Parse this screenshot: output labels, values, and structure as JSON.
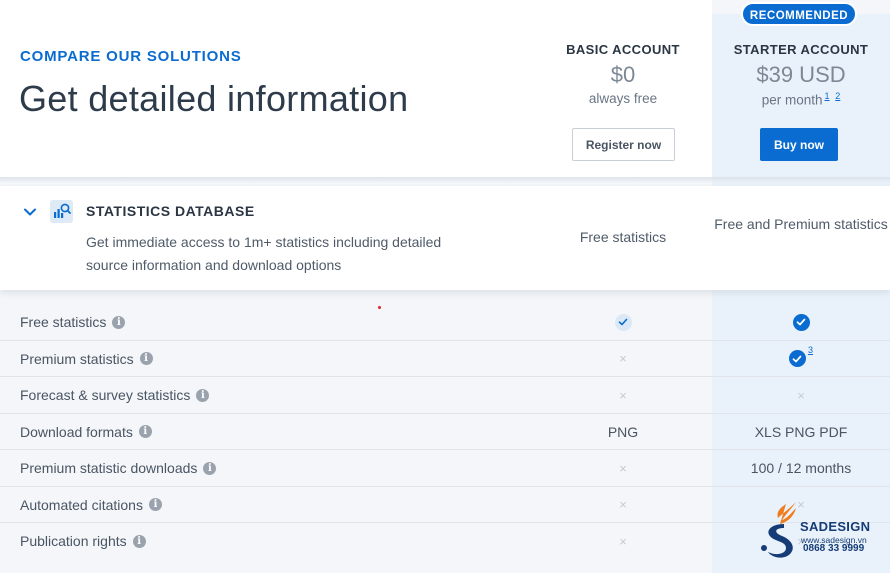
{
  "header": {
    "eyebrow": "COMPARE OUR SOLUTIONS",
    "title": "Get detailed information"
  },
  "plans": {
    "basic": {
      "title": "BASIC ACCOUNT",
      "price": "$0",
      "subtitle": "always free",
      "button": "Register now"
    },
    "starter": {
      "badge": "RECOMMENDED",
      "title": "STARTER ACCOUNT",
      "price": "$39 USD",
      "subtitle": "per month",
      "footnote_1": "1",
      "footnote_2": "2",
      "button": "Buy now"
    }
  },
  "category": {
    "title": "STATISTICS DATABASE",
    "description": "Get immediate access to 1m+ statistics including detailed source information and download options",
    "basic_value": "Free statistics",
    "starter_value": "Free and Premium statistics",
    "chevron_icon": "chevron-down-icon",
    "category_icon": "chart-search-icon"
  },
  "features": [
    {
      "label": "Free statistics",
      "basic": "check",
      "starter": "check"
    },
    {
      "label": "Premium statistics",
      "basic": "x",
      "starter": "check",
      "starter_footnote": "3"
    },
    {
      "label": "Forecast & survey statistics",
      "basic": "x",
      "starter": "x"
    },
    {
      "label": "Download formats",
      "basic_text": "PNG",
      "starter_text": "XLS PNG PDF"
    },
    {
      "label": "Premium statistic downloads",
      "basic": "x",
      "starter_text": "100 / 12 months"
    },
    {
      "label": "Automated citations",
      "basic": "x",
      "starter": "x"
    },
    {
      "label": "Publication rights",
      "basic": "x",
      "starter": "x"
    }
  ],
  "glyphs": {
    "info": "i",
    "x": "×"
  },
  "watermark": {
    "brand": "SADESIGN",
    "url": "www.sadesign.vn",
    "phone": "0868 33 9999"
  },
  "colors": {
    "accent": "#0a6cd0",
    "starter_column": "#e9f1fa",
    "text": "#3a4a5c"
  }
}
